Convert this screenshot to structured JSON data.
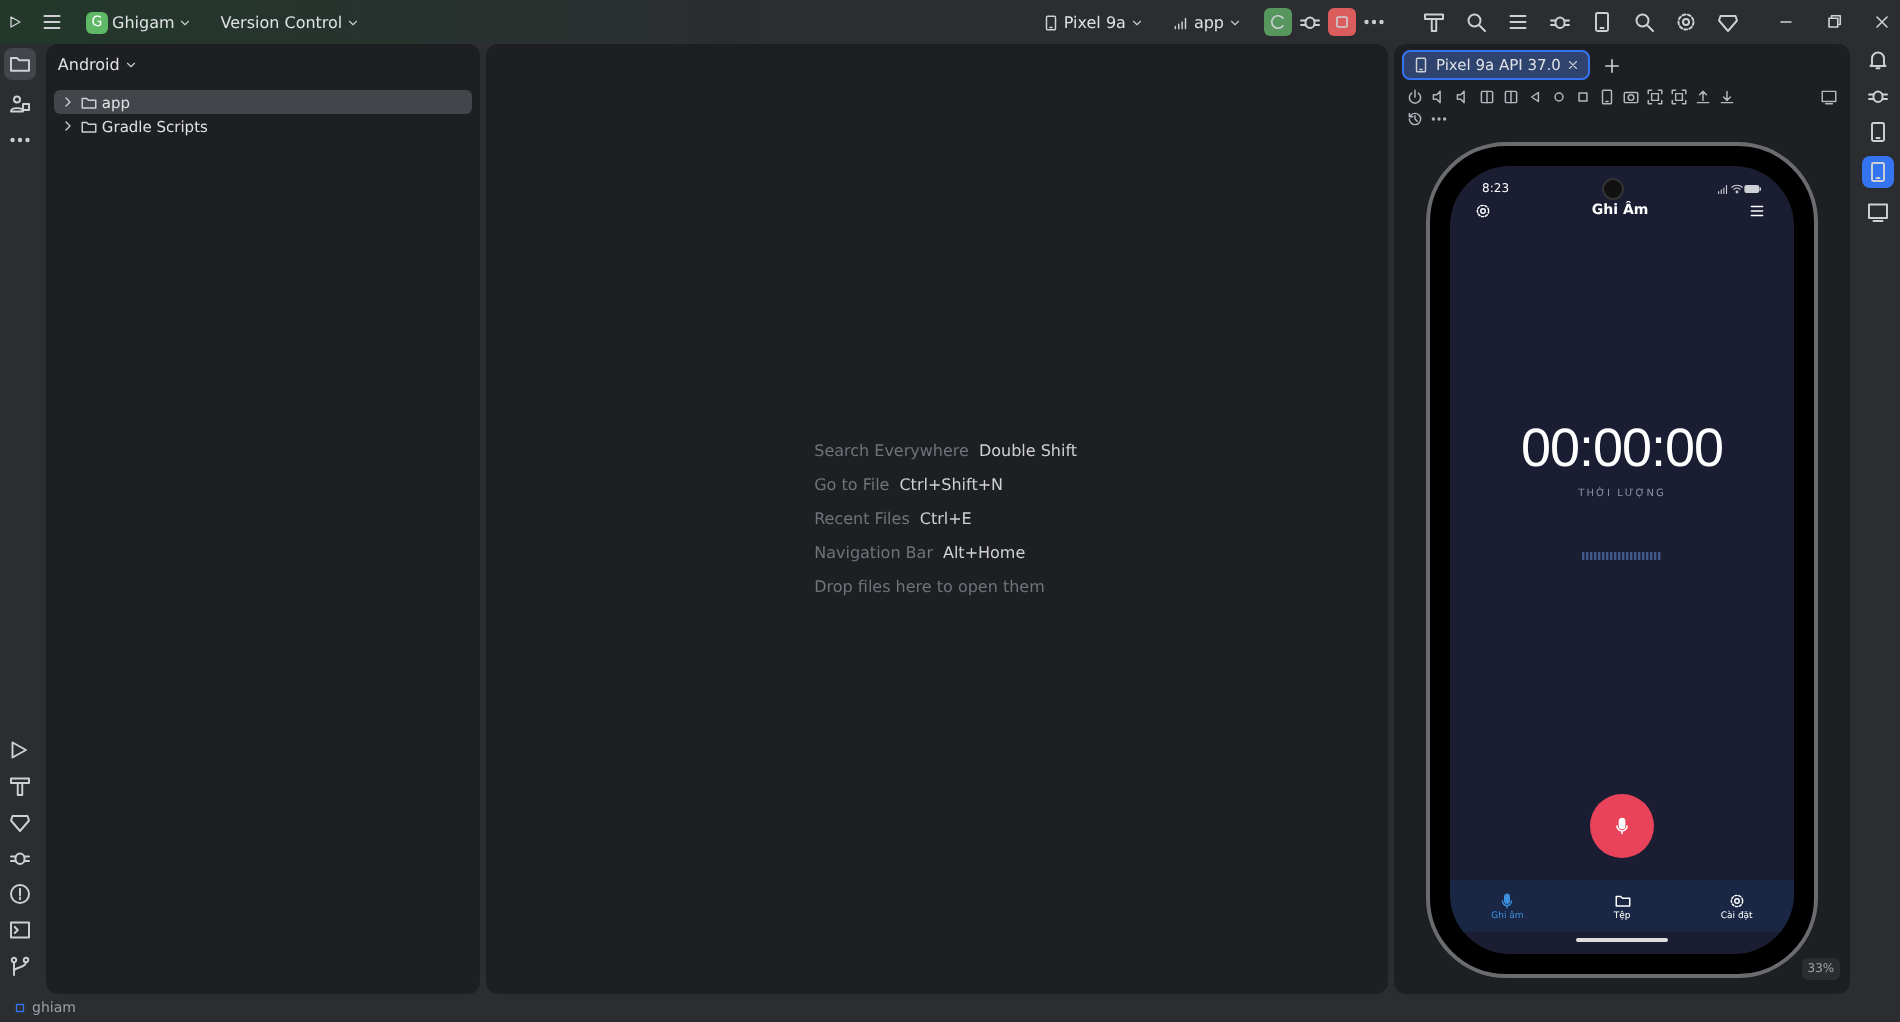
{
  "title_bar": {
    "project_initial": "G",
    "project": "Ghigam",
    "vcs": "Version Control",
    "device": "Pixel 9a",
    "run_config": "app"
  },
  "project_panel": {
    "view": "Android",
    "tree": [
      {
        "label": "app",
        "expanded": false,
        "selected": true
      },
      {
        "label": "Gradle Scripts",
        "expanded": false,
        "selected": false
      }
    ]
  },
  "editor_hints": [
    {
      "action": "Search Everywhere",
      "shortcut": "Double Shift"
    },
    {
      "action": "Go to File",
      "shortcut": "Ctrl+Shift+N"
    },
    {
      "action": "Recent Files",
      "shortcut": "Ctrl+E"
    },
    {
      "action": "Navigation Bar",
      "shortcut": "Alt+Home"
    },
    {
      "action": "Drop files here to open them"
    }
  ],
  "emulator": {
    "tab": {
      "label": "Pixel 9a API 37.0",
      "selected": true
    },
    "zoom": "33%"
  },
  "phone": {
    "time": "8:23",
    "title": "Ghi Âm",
    "timer": "00:00:00",
    "timer_label": "THỜI LƯỢNG",
    "nav": [
      {
        "label": "Ghi âm",
        "kind": "mic",
        "selected": true
      },
      {
        "label": "Tệp",
        "kind": "folder",
        "selected": false
      },
      {
        "label": "Cài đặt",
        "kind": "gear",
        "selected": false
      }
    ]
  },
  "status_bar": {
    "path": "ghiam"
  }
}
